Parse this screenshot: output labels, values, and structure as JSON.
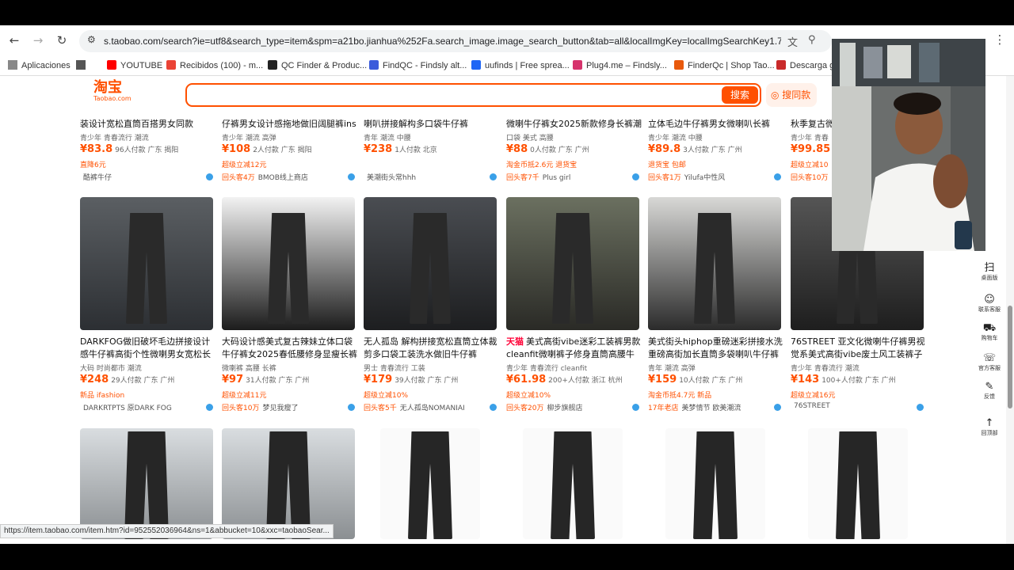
{
  "browser": {
    "url": "s.taobao.com/search?ie=utf8&search_type=item&spm=a21bo.jianhua%252Fa.search_image.image_search_button&tab=all&localImgKey=localImgSearchKey1.760.6...",
    "status_url": "https://item.taobao.com/item.htm?id=952552036964&ns=1&abbucket=10&xxc=taobaoSear...",
    "bookmarks": [
      {
        "label": "Aplicaciones",
        "color": "#666666"
      },
      {
        "label": "",
        "color": "#555555"
      },
      {
        "label": "YOUTUBE",
        "color": "#ff0000"
      },
      {
        "label": "Recibidos (100) - m...",
        "color": "#ea4335"
      },
      {
        "label": "QC Finder & Produc...",
        "color": "#222222"
      },
      {
        "label": "FindQC - Findsly alt...",
        "color": "#3b5bdb"
      },
      {
        "label": "uufinds | Free sprea...",
        "color": "#1e66f5"
      },
      {
        "label": "Plug4.me – Findsly...",
        "color": "#d6336c"
      },
      {
        "label": "FinderQc | Shop Tao...",
        "color": "#e8590c"
      },
      {
        "label": "Descarga gr",
        "color": "#c92a2a"
      }
    ]
  },
  "taobao": {
    "logo": "淘宝",
    "logo_sub": "Taobao.com",
    "search_button": "搜索",
    "photo_search": "搜同款"
  },
  "top_row": [
    {
      "title": "装设计宽松直筒百搭男女同款",
      "tags": "青少年   青春流行   潮流",
      "price": "¥83.8",
      "meta": "96人付款  广东 揭阳",
      "promo": "直降6元",
      "shop_hot": "",
      "shop": "酷裤牛仔"
    },
    {
      "title": "仔裤男女设计感拖地做旧阔腿裤ins",
      "tags": "青少年   潮流   高弹",
      "price": "¥108",
      "meta": "2人付款  广东 揭阳",
      "promo": "超级立减12元",
      "shop_hot": "回头客4万",
      "shop": "BMOB线上商店"
    },
    {
      "title": "喇叭拼接解构多口袋牛仔裤",
      "tags": "青年   潮流   中腰",
      "price": "¥238",
      "meta": "1人付款  北京",
      "promo": "",
      "shop_hot": "",
      "shop": "美潮街头常hhh"
    },
    {
      "title": "微喇牛仔裤女2025新款修身长裤潮",
      "tags": "口袋   美式   高腰",
      "price": "¥88",
      "meta": "0人付款  广东 广州",
      "promo": "淘金币抵2.6元  退货宝",
      "shop_hot": "回头客7千",
      "shop": "Plus girl"
    },
    {
      "title": "立体毛边牛仔裤男女微喇叭长裤",
      "tags": "青少年   潮流   中腰",
      "price": "¥89.8",
      "meta": "3人付款  广东 广州",
      "promo": "退货宝  包邮",
      "shop_hot": "回头客1万",
      "shop": "Yilufa中性风"
    },
    {
      "title": "秋季复古微喇",
      "tags": "青少年   青春",
      "price": "¥99.85",
      "meta": "3",
      "promo": "超级立减10",
      "shop_hot": "回头客10万",
      "shop": ""
    }
  ],
  "mid_row": [
    {
      "title": "DARKFOG做旧破坏毛边拼接设计感牛仔裤高街个性微喇男女宽松长裤",
      "tags": "大码   时尚都市   潮流",
      "price": "¥248",
      "meta": "29人付款  广东 广州",
      "promo": "新品  ifashion",
      "shop_hot": "",
      "shop": "DARKRTPTS 原DARK FOG",
      "badge": ""
    },
    {
      "title": "大码设计感美式复古辣妹立体口袋牛仔裤女2025春低腰修身显瘦长裤",
      "tags": "微喇裤   高腰   长裤",
      "price": "¥97",
      "meta": "31人付款  广东 广州",
      "promo": "超级立减11元",
      "shop_hot": "回头客10万",
      "shop": "梦见我瘦了",
      "badge": ""
    },
    {
      "title": "无人孤岛 解构拼接宽松直筒立体裁剪多口袋工装洗水做旧牛仔裤",
      "tags": "男士   青春流行   工装",
      "price": "¥179",
      "meta": "39人付款  广东 广州",
      "promo": "超级立减10%",
      "shop_hot": "回头客5千",
      "shop": "无人孤岛NOMANIAI",
      "badge": ""
    },
    {
      "title": "美式高街vibe迷彩工装裤男款cleanfit微喇裤子修身直筒高腰牛仔...",
      "tags": "青少年   青春流行   cleanfit",
      "price": "¥61.98",
      "meta": "200+人付款  浙江 杭州",
      "promo": "超级立减10%",
      "shop_hot": "回头客20万",
      "shop": "柳步旗舰店",
      "badge": "天猫"
    },
    {
      "title": "美式街头hiphop重磅迷彩拼接水洗重磅高街加长直筒多袋喇叭牛仔裤",
      "tags": "青年   潮流   高弹",
      "price": "¥159",
      "meta": "10人付款  广东 广州",
      "promo": "淘金币抵4.7元  新品",
      "shop_hot": "17年老店",
      "shop": "美梦情节 欧美潮流",
      "badge": ""
    },
    {
      "title": "76STREET 亚文化微喇牛仔裤男视觉系美式高街vibe废土风工装裤子",
      "tags": "青少年   青春流行   潮流",
      "price": "¥143",
      "meta": "100+人付款  广东 广州",
      "promo": "超级立减16元",
      "shop_hot": "",
      "shop": "76STREET",
      "badge": ""
    }
  ],
  "sidebar": [
    {
      "icon": "扫",
      "label": "桌面版"
    },
    {
      "icon": "☺",
      "label": "联系客服"
    },
    {
      "icon": "⛟",
      "label": "购物车"
    },
    {
      "icon": "☏",
      "label": "官方客服"
    },
    {
      "icon": "✎",
      "label": "反馈"
    },
    {
      "icon": "↑",
      "label": "回顶部"
    }
  ]
}
